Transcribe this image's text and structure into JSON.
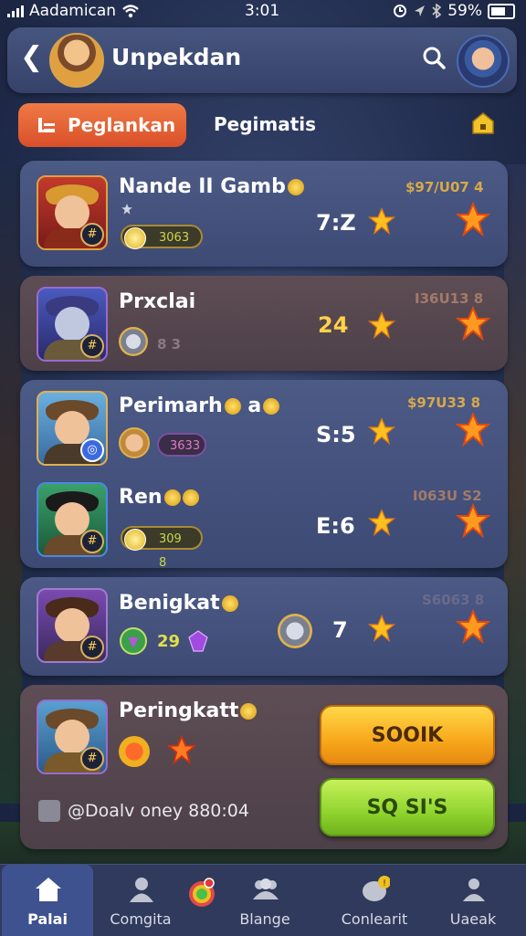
{
  "status_bar": {
    "carrier": "Aadamican",
    "time": "3:01",
    "battery": "59%"
  },
  "header": {
    "title": "Unpekdan"
  },
  "tabs": [
    {
      "label": "Peglankan",
      "active": true
    },
    {
      "label": "Pegimatis",
      "active": false
    }
  ],
  "players": [
    {
      "name": "Nande II Gamb",
      "pill": "3063",
      "score": "7:Z",
      "reward": "$97/U07 4"
    },
    {
      "name": "Prxclai",
      "pill": "8 3",
      "score": "24",
      "reward": "I36U13 8"
    },
    {
      "name": "Perimarh",
      "name_suffix": "a",
      "pill": "3633",
      "score": "S:5",
      "reward": "$97U33 8"
    },
    {
      "name": "Ren",
      "pill": "309 8",
      "score": "E:6",
      "reward": "I063U S2"
    },
    {
      "name": "Benigkat",
      "pill": "29",
      "score": "7",
      "reward": "S6063 8"
    }
  ],
  "bottom_card": {
    "name": "Peringkatt",
    "primary_button": "SOOIK",
    "secondary_button": "SQ SI'S",
    "footer": "@Doalv oney 880:04"
  },
  "nav": [
    {
      "label": "Palai",
      "active": true
    },
    {
      "label": "Comgita",
      "active": false
    },
    {
      "label": "",
      "active": false
    },
    {
      "label": "Blange",
      "active": false
    },
    {
      "label": "Conlearit",
      "active": false
    },
    {
      "label": "Uaeak",
      "active": false
    }
  ],
  "colors": {
    "accent_orange": "#e8643a",
    "card_blue": "#46547e",
    "card_brown": "#574850",
    "button_yellow": "#f7b12a",
    "button_green": "#9edb38"
  }
}
